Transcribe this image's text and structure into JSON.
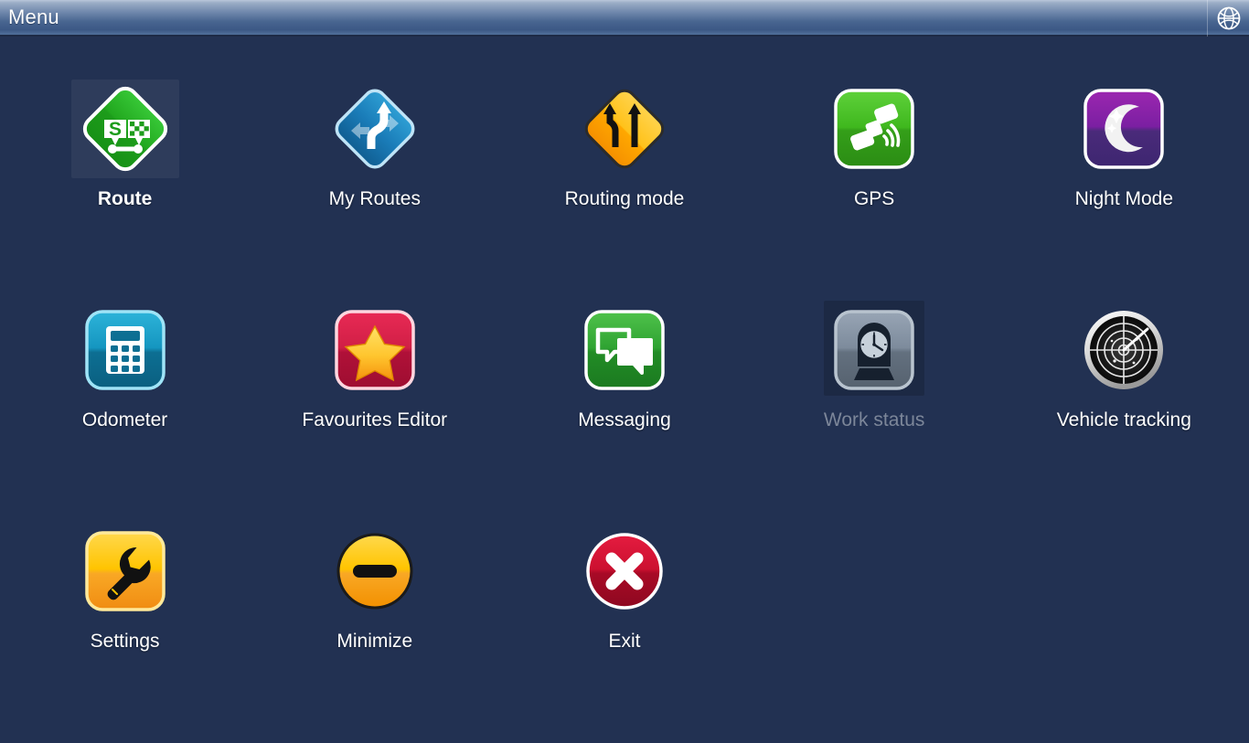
{
  "titlebar": {
    "title": "Menu",
    "globe_icon": "globe-icon"
  },
  "menu": {
    "rows": [
      [
        {
          "label": "Route",
          "icon": "route-icon",
          "state": "selected"
        },
        {
          "label": "My Routes",
          "icon": "my-routes-icon",
          "state": "normal"
        },
        {
          "label": "Routing mode",
          "icon": "routing-mode-icon",
          "state": "normal"
        },
        {
          "label": "GPS",
          "icon": "gps-icon",
          "state": "normal"
        },
        {
          "label": "Night Mode",
          "icon": "night-mode-icon",
          "state": "normal"
        }
      ],
      [
        {
          "label": "Odometer",
          "icon": "odometer-icon",
          "state": "normal"
        },
        {
          "label": "Favourites Editor",
          "icon": "favourites-editor-icon",
          "state": "normal"
        },
        {
          "label": "Messaging",
          "icon": "messaging-icon",
          "state": "normal"
        },
        {
          "label": "Work status",
          "icon": "work-status-icon",
          "state": "disabled"
        },
        {
          "label": "Vehicle tracking",
          "icon": "vehicle-tracking-icon",
          "state": "normal"
        }
      ],
      [
        {
          "label": "Settings",
          "icon": "settings-icon",
          "state": "normal"
        },
        {
          "label": "Minimize",
          "icon": "minimize-icon",
          "state": "normal"
        },
        {
          "label": "Exit",
          "icon": "exit-icon",
          "state": "normal"
        }
      ]
    ]
  },
  "colors": {
    "background": "#223152",
    "titlebar_top": "#b9c6da",
    "titlebar_bottom": "#3c5885",
    "label": "#ffffff",
    "label_disabled": "#7c8699",
    "route_green": "#2db52d",
    "my_routes_blue": "#1a7cb8",
    "routing_mode_orange": "#ffb300",
    "gps_green": "#3cb521",
    "night_mode_purple": "#7b1fa2",
    "odometer_cyan": "#0f8fb5",
    "favourites_red": "#cc1f45",
    "messaging_green": "#2fa332",
    "work_status_grey": "#8a97a8",
    "vehicle_tracking_dark": "#1a1a1a",
    "settings_yellow": "#ffc400",
    "minimize_yellow": "#ffc400",
    "exit_red": "#cc1030"
  }
}
